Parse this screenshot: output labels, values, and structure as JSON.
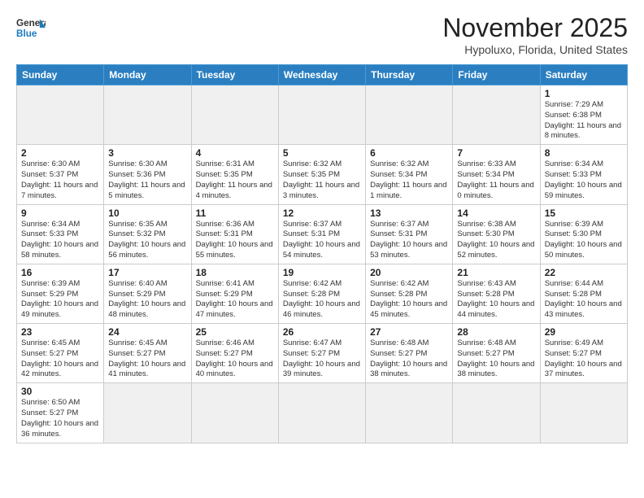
{
  "header": {
    "logo_general": "General",
    "logo_blue": "Blue",
    "month_title": "November 2025",
    "subtitle": "Hypoluxo, Florida, United States"
  },
  "weekdays": [
    "Sunday",
    "Monday",
    "Tuesday",
    "Wednesday",
    "Thursday",
    "Friday",
    "Saturday"
  ],
  "weeks": [
    [
      {
        "day": "",
        "info": ""
      },
      {
        "day": "",
        "info": ""
      },
      {
        "day": "",
        "info": ""
      },
      {
        "day": "",
        "info": ""
      },
      {
        "day": "",
        "info": ""
      },
      {
        "day": "",
        "info": ""
      },
      {
        "day": "1",
        "info": "Sunrise: 7:29 AM\nSunset: 6:38 PM\nDaylight: 11 hours\nand 8 minutes."
      }
    ],
    [
      {
        "day": "2",
        "info": "Sunrise: 6:30 AM\nSunset: 5:37 PM\nDaylight: 11 hours\nand 7 minutes."
      },
      {
        "day": "3",
        "info": "Sunrise: 6:30 AM\nSunset: 5:36 PM\nDaylight: 11 hours\nand 5 minutes."
      },
      {
        "day": "4",
        "info": "Sunrise: 6:31 AM\nSunset: 5:35 PM\nDaylight: 11 hours\nand 4 minutes."
      },
      {
        "day": "5",
        "info": "Sunrise: 6:32 AM\nSunset: 5:35 PM\nDaylight: 11 hours\nand 3 minutes."
      },
      {
        "day": "6",
        "info": "Sunrise: 6:32 AM\nSunset: 5:34 PM\nDaylight: 11 hours\nand 1 minute."
      },
      {
        "day": "7",
        "info": "Sunrise: 6:33 AM\nSunset: 5:34 PM\nDaylight: 11 hours\nand 0 minutes."
      },
      {
        "day": "8",
        "info": "Sunrise: 6:34 AM\nSunset: 5:33 PM\nDaylight: 10 hours\nand 59 minutes."
      }
    ],
    [
      {
        "day": "9",
        "info": "Sunrise: 6:34 AM\nSunset: 5:33 PM\nDaylight: 10 hours\nand 58 minutes."
      },
      {
        "day": "10",
        "info": "Sunrise: 6:35 AM\nSunset: 5:32 PM\nDaylight: 10 hours\nand 56 minutes."
      },
      {
        "day": "11",
        "info": "Sunrise: 6:36 AM\nSunset: 5:31 PM\nDaylight: 10 hours\nand 55 minutes."
      },
      {
        "day": "12",
        "info": "Sunrise: 6:37 AM\nSunset: 5:31 PM\nDaylight: 10 hours\nand 54 minutes."
      },
      {
        "day": "13",
        "info": "Sunrise: 6:37 AM\nSunset: 5:31 PM\nDaylight: 10 hours\nand 53 minutes."
      },
      {
        "day": "14",
        "info": "Sunrise: 6:38 AM\nSunset: 5:30 PM\nDaylight: 10 hours\nand 52 minutes."
      },
      {
        "day": "15",
        "info": "Sunrise: 6:39 AM\nSunset: 5:30 PM\nDaylight: 10 hours\nand 50 minutes."
      }
    ],
    [
      {
        "day": "16",
        "info": "Sunrise: 6:39 AM\nSunset: 5:29 PM\nDaylight: 10 hours\nand 49 minutes."
      },
      {
        "day": "17",
        "info": "Sunrise: 6:40 AM\nSunset: 5:29 PM\nDaylight: 10 hours\nand 48 minutes."
      },
      {
        "day": "18",
        "info": "Sunrise: 6:41 AM\nSunset: 5:29 PM\nDaylight: 10 hours\nand 47 minutes."
      },
      {
        "day": "19",
        "info": "Sunrise: 6:42 AM\nSunset: 5:28 PM\nDaylight: 10 hours\nand 46 minutes."
      },
      {
        "day": "20",
        "info": "Sunrise: 6:42 AM\nSunset: 5:28 PM\nDaylight: 10 hours\nand 45 minutes."
      },
      {
        "day": "21",
        "info": "Sunrise: 6:43 AM\nSunset: 5:28 PM\nDaylight: 10 hours\nand 44 minutes."
      },
      {
        "day": "22",
        "info": "Sunrise: 6:44 AM\nSunset: 5:28 PM\nDaylight: 10 hours\nand 43 minutes."
      }
    ],
    [
      {
        "day": "23",
        "info": "Sunrise: 6:45 AM\nSunset: 5:27 PM\nDaylight: 10 hours\nand 42 minutes."
      },
      {
        "day": "24",
        "info": "Sunrise: 6:45 AM\nSunset: 5:27 PM\nDaylight: 10 hours\nand 41 minutes."
      },
      {
        "day": "25",
        "info": "Sunrise: 6:46 AM\nSunset: 5:27 PM\nDaylight: 10 hours\nand 40 minutes."
      },
      {
        "day": "26",
        "info": "Sunrise: 6:47 AM\nSunset: 5:27 PM\nDaylight: 10 hours\nand 39 minutes."
      },
      {
        "day": "27",
        "info": "Sunrise: 6:48 AM\nSunset: 5:27 PM\nDaylight: 10 hours\nand 38 minutes."
      },
      {
        "day": "28",
        "info": "Sunrise: 6:48 AM\nSunset: 5:27 PM\nDaylight: 10 hours\nand 38 minutes."
      },
      {
        "day": "29",
        "info": "Sunrise: 6:49 AM\nSunset: 5:27 PM\nDaylight: 10 hours\nand 37 minutes."
      }
    ],
    [
      {
        "day": "30",
        "info": "Sunrise: 6:50 AM\nSunset: 5:27 PM\nDaylight: 10 hours\nand 36 minutes."
      },
      {
        "day": "",
        "info": ""
      },
      {
        "day": "",
        "info": ""
      },
      {
        "day": "",
        "info": ""
      },
      {
        "day": "",
        "info": ""
      },
      {
        "day": "",
        "info": ""
      },
      {
        "day": "",
        "info": ""
      }
    ]
  ]
}
